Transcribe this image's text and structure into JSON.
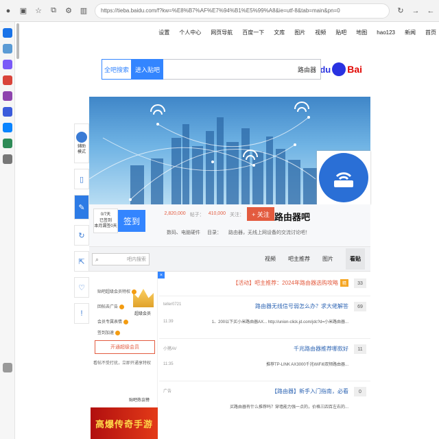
{
  "browser": {
    "url": "https://tieba.baidu.com/f?kw=%E8%B7%AF%E7%94%B1%E5%99%A8&ie=utf-8&tab=main&pn=0"
  },
  "topnav": {
    "items": [
      "首页",
      "新闻",
      "hao123",
      "地图",
      "贴吧",
      "视频",
      "图片",
      "文库",
      "百度一下",
      "网页导航",
      "个人中心",
      "设置"
    ]
  },
  "search": {
    "logo_bai": "Bai",
    "logo_du": "du",
    "logo_tb": "贴吧",
    "input_value": "路由器",
    "enter_label": "进入贴吧",
    "global_label": "全吧搜索"
  },
  "forum": {
    "name": "路由器吧",
    "follow_label": "+ 关注",
    "stats_follow_label": "关注：",
    "stats_follow": "410,000",
    "stats_posts_label": "帖子：",
    "stats_posts": "2,820,000",
    "intro_left": "路由器，无线上网设备的交流讨论吧！",
    "intro_mid": "目录：",
    "intro_right": "数码、电脑硬件",
    "sign_label": "签到",
    "sign_info_1": "0/7天",
    "sign_info_2": "已签到",
    "sign_info_3": "本月漏签0天"
  },
  "tabs": {
    "items": [
      "看贴",
      "图片",
      "吧主推荐",
      "视频"
    ],
    "search_placeholder": "吧内搜索"
  },
  "side_tools": {
    "helper_line1": "辅助",
    "helper_line2": "模式"
  },
  "threads": [
    {
      "count": "33",
      "title": "【活动】吧主推荐：2024年路由器选购攻略",
      "title_red": true,
      "tag": "精",
      "sub": "",
      "author": "",
      "time": ""
    },
    {
      "count": "69",
      "title": "路由器无线信号弱怎么办？求大佬解答",
      "title_red": false,
      "tag": "",
      "sub": "1、200以下买小米路由器AX... http://union-click.jd.com/jdc?d=小米路由器...",
      "author": "teller0721",
      "time": "11:39"
    },
    {
      "count": "11",
      "title": "千兆路由器推荐哪款好",
      "title_red": false,
      "tag": "",
      "sub": "推荐TP-LINK AX3000千兆WiFi6双频路由器...",
      "author": "小猪AV",
      "time": "11:35"
    },
    {
      "count": "0",
      "title": "【路由器】新手入门指南，必看",
      "title_red": false,
      "tag": "",
      "sub": "买路由器有什么推荐吗？穿墙能力强一点的，价格三四百左右的...",
      "author": "广告",
      "time": ""
    }
  ],
  "member": {
    "title": "超级会员",
    "perk1": "贴吧超级会员特权",
    "perk2": "回帖去广告",
    "perk3": "会员专属表情",
    "perk4": "签到加速",
    "open_label": "开通超级会员",
    "open_note": "看帖不受打扰，立即开通享特权",
    "hot_title": "贴吧热议榜"
  },
  "ad": {
    "text": "高爆传奇手游"
  }
}
